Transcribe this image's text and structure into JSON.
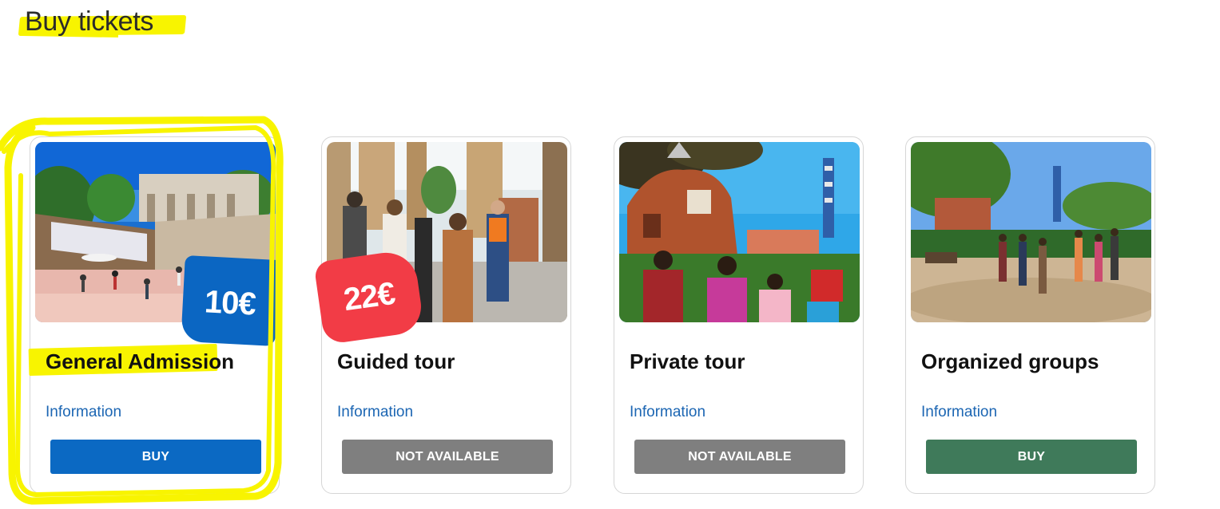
{
  "page": {
    "title": "Buy tickets"
  },
  "colors": {
    "highlight": "#f8f400",
    "link": "#1c66b3",
    "buy_blue": "#0b69c3",
    "not_available_gray": "#7f7f7f",
    "buy_green": "#3f7a5a",
    "price_blue": "#0b66c2",
    "price_red": "#f23c46"
  },
  "cards": [
    {
      "title": "General Admission",
      "price": "10€",
      "info_label": "Information",
      "button_label": "BUY",
      "image": "park-terrace-photo"
    },
    {
      "title": "Guided tour",
      "price": "22€",
      "info_label": "Information",
      "button_label": "NOT AVAILABLE",
      "image": "guided-group-photo"
    },
    {
      "title": "Private tour",
      "info_label": "Information",
      "button_label": "NOT AVAILABLE",
      "image": "gatehouse-family-photo"
    },
    {
      "title": "Organized groups",
      "info_label": "Information",
      "button_label": "BUY",
      "image": "plaza-group-photo"
    }
  ]
}
